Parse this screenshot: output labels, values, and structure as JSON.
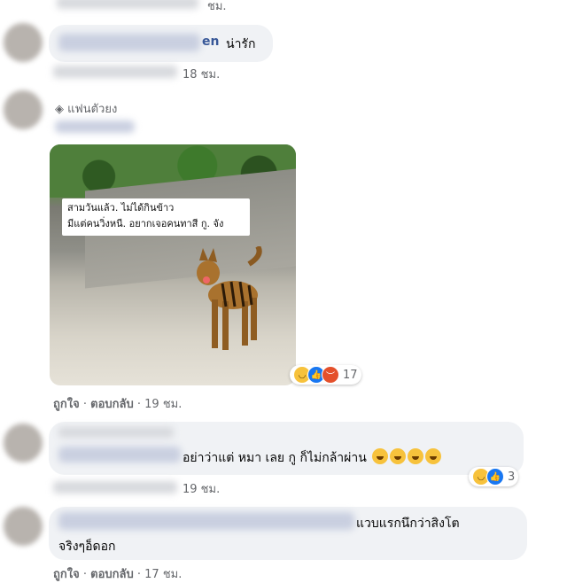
{
  "comments": [
    {
      "text": "น่ารัก",
      "name_suffix": "en",
      "actions": {
        "time": "18 ชม."
      }
    },
    {
      "badge": "แฟนตัวยง",
      "image_caption_line1": "สามวันแล้ว. ไม่ได้กินข้าว",
      "image_caption_line2": "มีแต่คนวิ่งหนี. อยากเจอคนทาสี กู. จัง",
      "actions": {
        "like": "ถูกใจ",
        "sep": "·",
        "reply": "ตอบกลับ",
        "time": "19 ชม."
      },
      "reaction_count": "17"
    },
    {
      "text": "อย่าว่าแต่ หมา เลย กู ก็ไม่กล้าผ่าน",
      "actions": {
        "time": "19 ชม."
      },
      "reaction_count": "3"
    },
    {
      "text_line1": "แวบแรกนึกว่าสิงโต",
      "text_line2": "จริงๆอ็ดอก",
      "actions": {
        "like": "ถูกใจ",
        "sep": "·",
        "reply": "ตอบกลับ",
        "time": "17 ชม."
      }
    }
  ],
  "top_actions_time": "ชม."
}
